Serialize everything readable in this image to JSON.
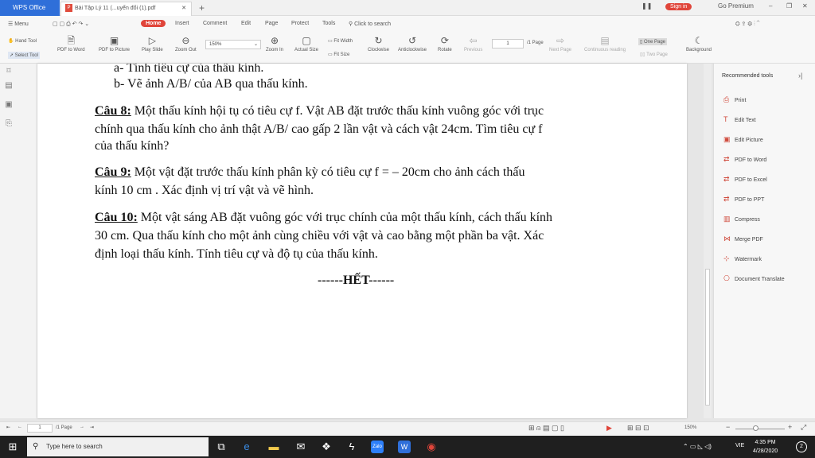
{
  "app": {
    "brand": "WPS Office",
    "tab_title": "Bài Tập Lý 11 (...uyển đổi (1).pdf",
    "sign_in": "Sign in",
    "go_premium": "Go Premium"
  },
  "menubar": {
    "menu": "Menu",
    "tabs": [
      "Home",
      "Insert",
      "Comment",
      "Edit",
      "Page",
      "Protect",
      "Tools"
    ],
    "search_placeholder": "Click to search"
  },
  "toolbar": {
    "hand_tool": "Hand Tool",
    "select_tool": "Select Tool",
    "pdf_to_word": "PDF to Word",
    "pdf_to_picture": "PDF to Picture",
    "play_slide": "Play Slide",
    "zoom_out": "Zoom Out",
    "zoom_value": "150%",
    "zoom_in": "Zoom In",
    "actual_size": "Actual Size",
    "fit_width": "Fit Width",
    "fit_size": "Fit Size",
    "clockwise": "Clockwise",
    "anticlockwise": "Anticlockwise",
    "rotate": "Rotate",
    "previous": "Previous",
    "page_current": "1",
    "page_total": "/1 Page",
    "next_page": "Next Page",
    "continuous_reading": "Continuous reading",
    "one_page": "One Page",
    "two_page": "Two Page",
    "background": "Background"
  },
  "document": {
    "line_a": "a-  Tính tiêu cự của thấu kính.",
    "line_b": "b-  Vẽ ảnh A/B/ của AB qua thấu kính.",
    "q8_label": "Câu 8:",
    "q8_l1": " Một thấu kính hội tụ có tiêu cự f. Vật AB đặt trước thấu kính vuông góc với trục",
    "q8_l2": "chính qua thấu kính cho ảnh thật A/B/ cao gấp 2 lần vật và cách vật 24cm. Tìm tiêu cự f",
    "q8_l3": "của thấu kính?",
    "q9_label": "Câu 9:",
    "q9_l1": "  Một vật đặt  trước thấu kính phân kỳ có tiêu cự f = – 20cm cho ảnh cách thấu",
    "q9_l2": "kính 10 cm . Xác định vị trí vật và vẽ hình.",
    "q10_label": "Câu 10:",
    "q10_l1": " Một vật sáng AB đặt vuông góc với trục chính của một thấu kính, cách thấu kính",
    "q10_l2": "30 cm. Qua thấu kính cho một ảnh cùng chiều với vật và cao bằng một phần ba vật. Xác",
    "q10_l3": "định loại thấu kính. Tính  tiêu cự và độ tụ của thấu kính.",
    "end": "------HẾT------"
  },
  "right_panel": {
    "title": "Recommended tools",
    "items": [
      "Print",
      "Edit Text",
      "Edit Picture",
      "PDF to Word",
      "PDF to Excel",
      "PDF to PPT",
      "Compress",
      "Merge PDF",
      "Watermark",
      "Document Translate"
    ]
  },
  "statusbar": {
    "page_current": "1",
    "page_total": "/1 Page",
    "zoom": "150%"
  },
  "taskbar": {
    "search_placeholder": "Type here to search",
    "language": "VIE",
    "time": "4:35 PM",
    "date": "4/28/2020",
    "notification_count": "2"
  },
  "colors": {
    "brand_blue": "#2f6fd9",
    "accent_red": "#e0453a",
    "taskbar": "#1f1f1f"
  }
}
